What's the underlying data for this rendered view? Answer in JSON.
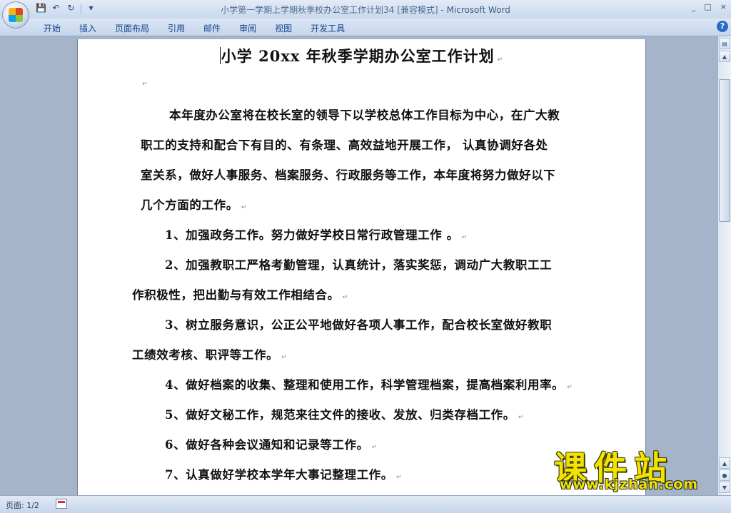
{
  "window": {
    "title": "小学第一学期上学期秋季校办公室工作计划34 [兼容模式]",
    "app_separator": " - ",
    "app_name": "Microsoft Word",
    "min_label": "_",
    "max_label": "□",
    "close_label": "×"
  },
  "quick_access": {
    "save_icon": "💾",
    "undo_icon": "↶",
    "redo_icon": "↻",
    "dropdown_icon": "▾"
  },
  "ribbon": {
    "tabs": [
      "开始",
      "插入",
      "页面布局",
      "引用",
      "邮件",
      "审阅",
      "视图",
      "开发工具"
    ],
    "help": "?"
  },
  "document": {
    "title": "小学 20xx 年秋季学期办公室工作计划",
    "paragraph_mark": "↵",
    "intro_lines": [
      "本年度办公室将在校长室的领导下以学校总体工作目标为中心，在广大教",
      "职工的支持和配合下有目的、有条理、高效益地开展工作，  认真协调好各处",
      "室关系，做好人事服务、档案服务、行政服务等工作，本年度将努力做好以下",
      "几个方面的工作。"
    ],
    "items": [
      {
        "lines": [
          "1、加强政务工作。努力做好学校日常行政管理工作 。"
        ]
      },
      {
        "lines": [
          "2、加强教职工严格考勤管理，认真统计，落实奖惩，调动广大教职工工",
          "作积极性，把出勤与有效工作相结合。"
        ]
      },
      {
        "lines": [
          "3、树立服务意识，公正公平地做好各项人事工作，配合校长室做好教职",
          "工绩效考核、职评等工作。"
        ]
      },
      {
        "lines": [
          "4、做好档案的收集、整理和使用工作，科学管理档案，提高档案利用率。"
        ]
      },
      {
        "lines": [
          "5、做好文秘工作，规范来往文件的接收、发放、归类存档工作。"
        ]
      },
      {
        "lines": [
          "6、做好各种会议通知和记录等工作。"
        ]
      },
      {
        "lines": [
          "7、认真做好学校本学年大事记整理工作。"
        ]
      }
    ]
  },
  "statusbar": {
    "page_info": "页面: 1/2"
  },
  "watermark": {
    "text": "课件站",
    "url": "www.kjzhan.com"
  }
}
